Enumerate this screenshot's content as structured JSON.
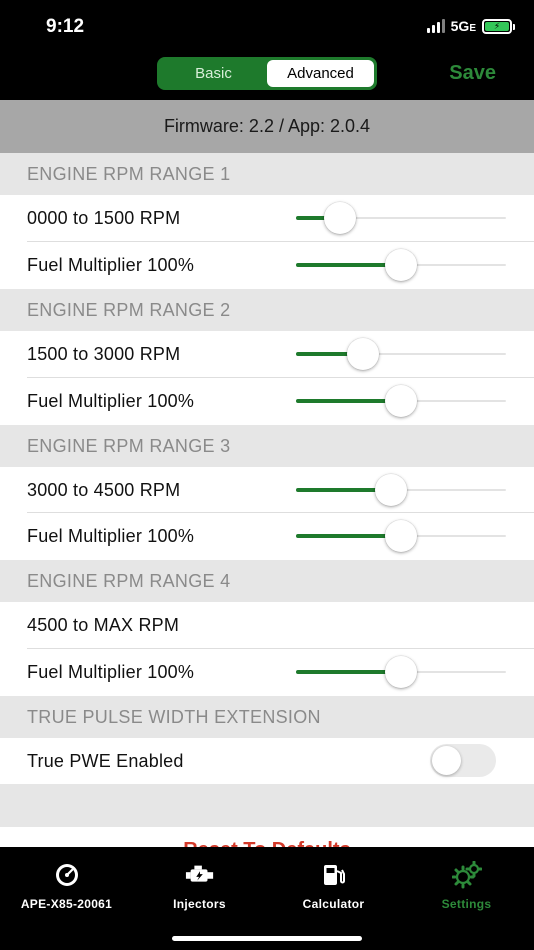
{
  "status": {
    "time": "9:12",
    "network": "5G",
    "network_sub": "E"
  },
  "header": {
    "segments": [
      {
        "label": "Basic",
        "active": false
      },
      {
        "label": "Advanced",
        "active": true
      }
    ],
    "save_label": "Save",
    "accent_color": "#1e7a2c"
  },
  "firmware_text": "Firmware: 2.2 / App: 2.0.4",
  "sections": [
    {
      "header": "ENGINE RPM RANGE 1",
      "rows": [
        {
          "label": "0000 to 1500 RPM",
          "slider_value": 0.21
        },
        {
          "label": "Fuel Multiplier 100%",
          "slider_value": 0.5
        }
      ]
    },
    {
      "header": "ENGINE RPM RANGE 2",
      "rows": [
        {
          "label": "1500 to 3000 RPM",
          "slider_value": 0.32
        },
        {
          "label": "Fuel Multiplier 100%",
          "slider_value": 0.5
        }
      ]
    },
    {
      "header": "ENGINE RPM RANGE 3",
      "rows": [
        {
          "label": "3000 to 4500 RPM",
          "slider_value": 0.45
        },
        {
          "label": "Fuel Multiplier 100%",
          "slider_value": 0.5
        }
      ]
    },
    {
      "header": "ENGINE RPM RANGE 4",
      "rows": [
        {
          "label": "4500 to MAX RPM"
        },
        {
          "label": "Fuel Multiplier 100%",
          "slider_value": 0.5
        }
      ]
    },
    {
      "header": "TRUE PULSE WIDTH EXTENSION",
      "rows": [
        {
          "label": "True PWE Enabled",
          "toggle_on": false
        }
      ]
    }
  ],
  "reset_label": "Reset To Defaults",
  "tabs": [
    {
      "label": "APE-X85-20061",
      "icon": "gauge-icon",
      "active": false
    },
    {
      "label": "Injectors",
      "icon": "engine-icon",
      "active": false
    },
    {
      "label": "Calculator",
      "icon": "fuel-pump-icon",
      "active": false
    },
    {
      "label": "Settings",
      "icon": "gears-icon",
      "active": true
    }
  ]
}
